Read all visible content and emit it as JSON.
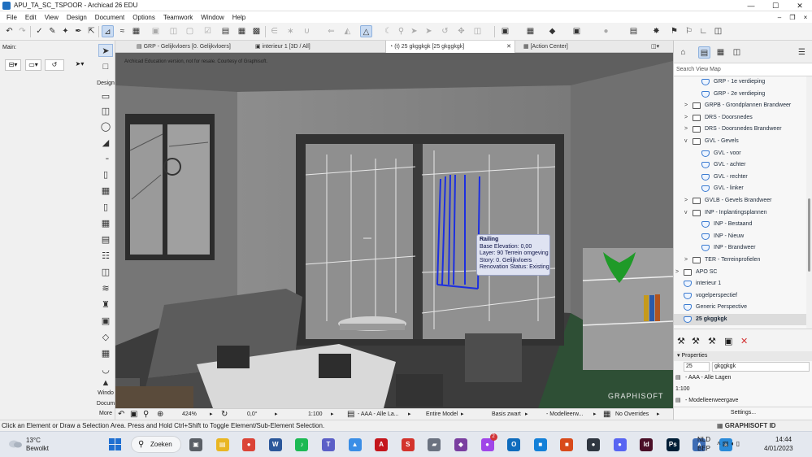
{
  "window": {
    "title": "APU_TA_SC_TSPOOR - Archicad 26 EDU",
    "controls": {
      "minimize": "—",
      "maximize": "☐",
      "close": "✕"
    }
  },
  "menu": {
    "items": [
      "File",
      "Edit",
      "View",
      "Design",
      "Document",
      "Options",
      "Teamwork",
      "Window",
      "Help"
    ],
    "right_controls": [
      "–",
      "❐",
      "×"
    ]
  },
  "infobox": {
    "label": "Main:",
    "controls": [
      "⊟▾",
      "▭▾",
      "↺",
      "➤▾"
    ]
  },
  "toolbox": {
    "design_label": "Design",
    "window_label": "Windo",
    "document_label": "Docum",
    "more_label": "More"
  },
  "tabs": [
    {
      "icon": "▤",
      "label": "GRP - Gelijkvloers [0. Gelijkvloers]"
    },
    {
      "icon": "▣",
      "label": "interieur 1 [3D / All]"
    },
    {
      "icon": "◔",
      "label": "(t) 25 gkggkgk [25 gkggkgk]",
      "close": "✕"
    },
    {
      "icon": "▦",
      "label": "[Action Center]"
    }
  ],
  "viewport": {
    "watermark": "Archicad Education version, not for resale. Courtesy of Graphisoft.",
    "brand": "GRAPHISOFT",
    "tooltip": {
      "title": "Railing",
      "lines": [
        "Base Elevation: 0,00",
        "Layer: 90 Terrein omgeving",
        "Story: 0. Gelijkvloers",
        "Renovation Status: Existing"
      ]
    }
  },
  "view_bottom": {
    "zoom": "424%",
    "angle": "0,0°",
    "scale": "1:100",
    "layer_combo": "- AAA - Alle La...",
    "model_filter": "Entire Model",
    "pen_set": "Basis zwart",
    "model_view": "- Modelleerw...",
    "overrides": "No Overrides"
  },
  "status": {
    "message": "Click an Element or Draw a Selection Area. Press and Hold Ctrl+Shift to Toggle Element/Sub-Element Selection.",
    "graphisoft_id": "GRAPHISOFT ID"
  },
  "navigator": {
    "search_placeholder": "Search View Map",
    "rows": [
      {
        "label": "GRP - 1e verdieping",
        "indent": 2,
        "icon": "view",
        "twisty": ""
      },
      {
        "label": "GRP - 2e verdieping",
        "indent": 2,
        "icon": "view",
        "twisty": ""
      },
      {
        "label": "GRPB - Grondplannen Brandweer",
        "indent": 1,
        "icon": "folder",
        "twisty": ">"
      },
      {
        "label": "DRS - Doorsnedes",
        "indent": 1,
        "icon": "folder",
        "twisty": ">"
      },
      {
        "label": "DRS - Doorsnedes Brandweer",
        "indent": 1,
        "icon": "folder",
        "twisty": ">"
      },
      {
        "label": "GVL - Gevels",
        "indent": 1,
        "icon": "folder",
        "twisty": "v"
      },
      {
        "label": "GVL - voor",
        "indent": 2,
        "icon": "view",
        "twisty": ""
      },
      {
        "label": "GVL - achter",
        "indent": 2,
        "icon": "view",
        "twisty": ""
      },
      {
        "label": "GVL - rechter",
        "indent": 2,
        "icon": "view",
        "twisty": ""
      },
      {
        "label": "GVL - linker",
        "indent": 2,
        "icon": "view",
        "twisty": ""
      },
      {
        "label": "GVLB - Gevels Brandweer",
        "indent": 1,
        "icon": "folder",
        "twisty": ">"
      },
      {
        "label": "INP - Inplantingsplannen",
        "indent": 1,
        "icon": "folder",
        "twisty": "v"
      },
      {
        "label": "INP - Bestaand",
        "indent": 2,
        "icon": "view",
        "twisty": ""
      },
      {
        "label": "INP - Nieuw",
        "indent": 2,
        "icon": "view",
        "twisty": ""
      },
      {
        "label": "INP - Brandweer",
        "indent": 2,
        "icon": "view",
        "twisty": ""
      },
      {
        "label": "TER - Terreinprofielen",
        "indent": 1,
        "icon": "folder",
        "twisty": ">"
      },
      {
        "label": "APO SC",
        "indent": 0,
        "icon": "folder",
        "twisty": ">"
      },
      {
        "label": "interieur 1",
        "indent": 0,
        "icon": "view",
        "twisty": ""
      },
      {
        "label": "vogelperspectief",
        "indent": 0,
        "icon": "view",
        "twisty": ""
      },
      {
        "label": "Generic Perspective",
        "indent": 0,
        "icon": "view",
        "twisty": ""
      },
      {
        "label": "25 gkggkgk",
        "indent": 0,
        "icon": "view",
        "twisty": "",
        "selected": true
      }
    ],
    "actions": [
      "⚒",
      "⚒",
      "⚒",
      "▣",
      "✕"
    ],
    "properties": {
      "header": "Properties",
      "id": "25",
      "name": "gkggkgk",
      "layer": "- AAA - Alle Lagen",
      "scale": "1:100",
      "model_view": "- Modelleerweergave",
      "settings_button": "Settings..."
    }
  },
  "taskbar": {
    "temperature": "13°C",
    "condition": "Bewolkt",
    "search_label": "Zoeken",
    "apps": [
      {
        "name": "task-view",
        "glyph": "▣",
        "color": "#5a5f66"
      },
      {
        "name": "file-explorer",
        "glyph": "▤",
        "color": "#e9b623"
      },
      {
        "name": "chrome",
        "glyph": "●",
        "color": "#db4437"
      },
      {
        "name": "word",
        "glyph": "W",
        "color": "#2b579a"
      },
      {
        "name": "spotify",
        "glyph": "♪",
        "color": "#1db954"
      },
      {
        "name": "teams",
        "glyph": "T",
        "color": "#5b5fc7"
      },
      {
        "name": "photos",
        "glyph": "▲",
        "color": "#3a8ee6"
      },
      {
        "name": "acrobat",
        "glyph": "A",
        "color": "#c4161c"
      },
      {
        "name": "sketchup",
        "glyph": "S",
        "color": "#d3332c"
      },
      {
        "name": "app-gray",
        "glyph": "▰",
        "color": "#6b7280"
      },
      {
        "name": "app-purple",
        "glyph": "◆",
        "color": "#7a3fa0"
      },
      {
        "name": "messenger",
        "glyph": "●",
        "color": "#a046e8",
        "badge": "2"
      },
      {
        "name": "outlook",
        "glyph": "O",
        "color": "#0f6cbd"
      },
      {
        "name": "app-blue",
        "glyph": "■",
        "color": "#1480d8"
      },
      {
        "name": "office",
        "glyph": "■",
        "color": "#d84a1b"
      },
      {
        "name": "app-dark",
        "glyph": "●",
        "color": "#2f3640"
      },
      {
        "name": "discord",
        "glyph": "●",
        "color": "#5865f2"
      },
      {
        "name": "indesign",
        "glyph": "Id",
        "color": "#4a0f27"
      },
      {
        "name": "photoshop",
        "glyph": "Ps",
        "color": "#001e36"
      },
      {
        "name": "archicad",
        "glyph": "∧",
        "color": "#3e6db5"
      },
      {
        "name": "app-light",
        "glyph": "▲",
        "color": "#2a8ad8"
      }
    ],
    "lang_top": "NLD",
    "lang_bottom": "BEP",
    "tray_icons": "˄  ▧  ◖  ▯",
    "time": "14:44",
    "date": "4/01/2023"
  },
  "colors": {
    "selection_blue": "#1c2fe0",
    "tooltip_bg": "#dfe3f2",
    "plant_green": "#1f9a28",
    "floor_green": "#2e4f35"
  }
}
